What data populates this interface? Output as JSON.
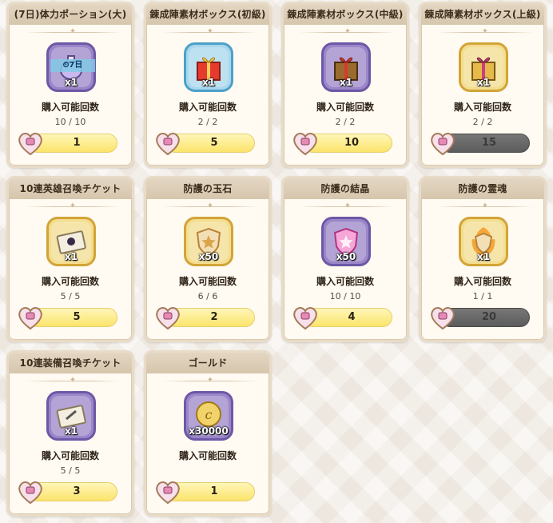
{
  "limit_label": "購入可能回数",
  "cards": [
    {
      "title": "(7日)体力ポーション(大)",
      "frame": "purple",
      "art": "potion-icon",
      "qty": "x1",
      "timer": "⏲7日",
      "count": "10 / 10",
      "price": "1",
      "disabled": false
    },
    {
      "title": "錬成陣素材ボックス(初級)",
      "frame": "blue",
      "art": "gift-box-red-icon",
      "qty": "x1",
      "count": "2 / 2",
      "price": "5",
      "disabled": false
    },
    {
      "title": "錬成陣素材ボックス(中級)",
      "frame": "purple",
      "art": "gift-box-dark-icon",
      "qty": "x1",
      "count": "2 / 2",
      "price": "10",
      "disabled": false
    },
    {
      "title": "錬成陣素材ボックス(上級)",
      "frame": "gold",
      "art": "gift-box-pink-icon",
      "qty": "x1",
      "count": "2 / 2",
      "price": "15",
      "disabled": true
    },
    {
      "title": "10連英雄召喚チケット",
      "frame": "gold",
      "art": "hero-ticket-icon",
      "qty": "x1",
      "count": "5 / 5",
      "price": "5",
      "disabled": false
    },
    {
      "title": "防護の玉石",
      "frame": "gold",
      "art": "shield-gem-icon",
      "qty": "x50",
      "count": "6 / 6",
      "price": "2",
      "disabled": false
    },
    {
      "title": "防護の結晶",
      "frame": "purple",
      "art": "shield-crystal-icon",
      "qty": "x50",
      "count": "10 / 10",
      "price": "4",
      "disabled": false
    },
    {
      "title": "防護の霊魂",
      "frame": "gold",
      "art": "shield-spirit-icon",
      "qty": "x1",
      "count": "1 / 1",
      "price": "20",
      "disabled": true
    },
    {
      "title": "10連装備召喚チケット",
      "frame": "purple",
      "art": "equip-ticket-icon",
      "qty": "x1",
      "count": "5 / 5",
      "price": "3",
      "disabled": false
    },
    {
      "title": "ゴールド",
      "frame": "purple",
      "art": "gold-coin-icon",
      "qty": "x30000",
      "count": "",
      "price": "1",
      "disabled": false
    }
  ],
  "currency_icon": "heart-gem-icon",
  "colors": {
    "accent": "#fbe46b",
    "disabled": "#5c5c5c",
    "purple": "#6d58a6",
    "gold": "#d2a437",
    "blue": "#4da0c8"
  }
}
